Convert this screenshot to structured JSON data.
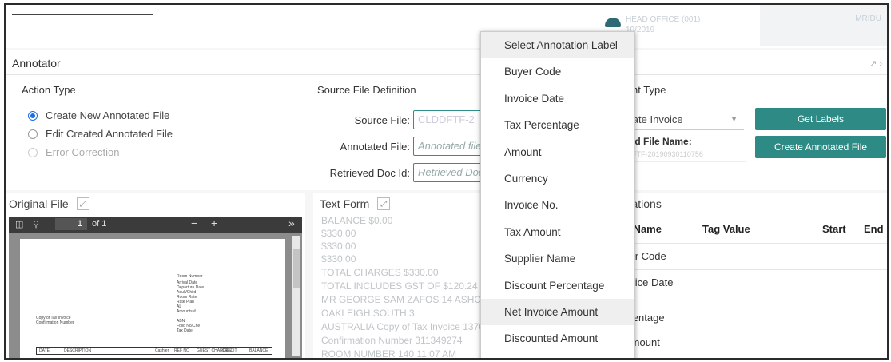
{
  "header": {
    "branch_text": "HEAD OFFICE (001)",
    "branch_date": "10/2019",
    "user_text": "MRIDU"
  },
  "annotator": {
    "title": "Annotator",
    "window_controls": "↗ ›",
    "action_type": {
      "label": "Action Type",
      "options": [
        {
          "label": "Create New Annotated File",
          "state": "selected"
        },
        {
          "label": "Edit Created Annotated File",
          "state": "normal"
        },
        {
          "label": "Error Correction",
          "state": "disabled"
        }
      ]
    },
    "source_definition": {
      "label": "Source File Definition",
      "source_file_label": "Source File:",
      "source_file_value": "CLDDFTF-2",
      "annotated_file_label": "Annotated File:",
      "annotated_file_placeholder": "Annotated file",
      "retrieved_doc_label": "Retrieved Doc Id:",
      "retrieved_doc_placeholder": "Retrieved Doc"
    },
    "document_type": {
      "label": "ment Type",
      "value": "porate Invoice",
      "get_labels_button": "Get Labels",
      "annotated_file_name_label": "tated File Name:",
      "annotated_file_name_value": "CLDFTF-20190930110756",
      "create_button": "Create Annotated File"
    }
  },
  "original_file": {
    "title": "Original File",
    "page_input": "1",
    "page_of": "of 1",
    "zoom_out": "−",
    "zoom_in": "+",
    "more": "»"
  },
  "text_form": {
    "title": "Text Form",
    "lines": [
      "BALANCE $0.00",
      "$330.00",
      "$330.00",
      "$330.00",
      "TOTAL CHARGES $330.00",
      "TOTAL INCLUDES GST OF $120.24",
      "MR GEORGE SAM ZAFOS 14 ASHCROFT",
      "OAKLEIGH SOUTH 3",
      "AUSTRALIA Copy of Tax Invoice 13769",
      "Confirmation Number 311349274",
      "ROOM NUMBER 140 11:07 AM"
    ]
  },
  "annotations": {
    "title": "notations",
    "columns": [
      "g Name",
      "Tag Value",
      "Start",
      "End"
    ],
    "rows": [
      {
        "name": "yer Code"
      },
      {
        "name": "voice Date"
      },
      {
        "name": "x rcentage"
      },
      {
        "name": "Amount"
      }
    ]
  },
  "label_dropdown": {
    "items": [
      "Select Annotation Label",
      "Buyer Code",
      "Invoice Date",
      "Tax Percentage",
      "Amount",
      "Currency",
      "Invoice No.",
      "Tax Amount",
      "Supplier Name",
      "Discount Percentage",
      "Net Invoice Amount",
      "Discounted Amount"
    ],
    "highlighted": [
      "Select Annotation Label",
      "Net Invoice Amount"
    ]
  },
  "colors": {
    "accent": "#2d8a85",
    "radio_selected": "#1e6ee6",
    "pdf_toolbar": "#3b3b3b"
  }
}
